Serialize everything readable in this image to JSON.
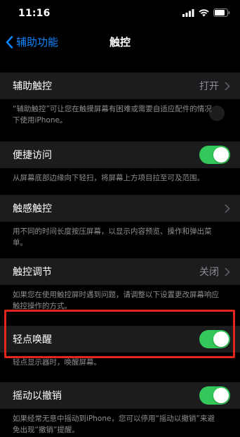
{
  "status_bar": {
    "time": "11:16"
  },
  "nav": {
    "back_label": "辅助功能",
    "title": "触控"
  },
  "sections": [
    {
      "label": "辅助触控",
      "value": "打开",
      "control": "chevron",
      "footer": "“辅助触控”可让您在触摸屏幕有困难或需要自适应配件的情况下使用iPhone。"
    },
    {
      "label": "便捷访问",
      "control": "toggle",
      "toggle_on": true,
      "footer": "从屏幕底部边缘向下轻扫，将屏幕上方项目拉至可及范围。"
    },
    {
      "label": "触感触控",
      "control": "chevron",
      "footer": "用不同的时间长度按压屏幕，以显示内容预览、操作和弹出菜单。"
    },
    {
      "label": "触控调节",
      "value": "关闭",
      "control": "chevron",
      "footer": "如果您在使用触控屏时遇到问题，请调整以下设置更改屏幕响应触控操作的方式。"
    },
    {
      "label": "轻点唤醒",
      "control": "toggle",
      "toggle_on": true,
      "footer": "轻点显示器时，唤醒屏幕。"
    },
    {
      "label": "摇动以撤销",
      "control": "toggle",
      "toggle_on": true,
      "footer": "如果经常无意中摇动到iPhone，您可以停用“摇动以撤销”来避免出现“撤销”提醒。"
    }
  ],
  "colors": {
    "accent": "#0a84ff",
    "toggle_on": "#34c759",
    "highlight": "#e2251d"
  }
}
